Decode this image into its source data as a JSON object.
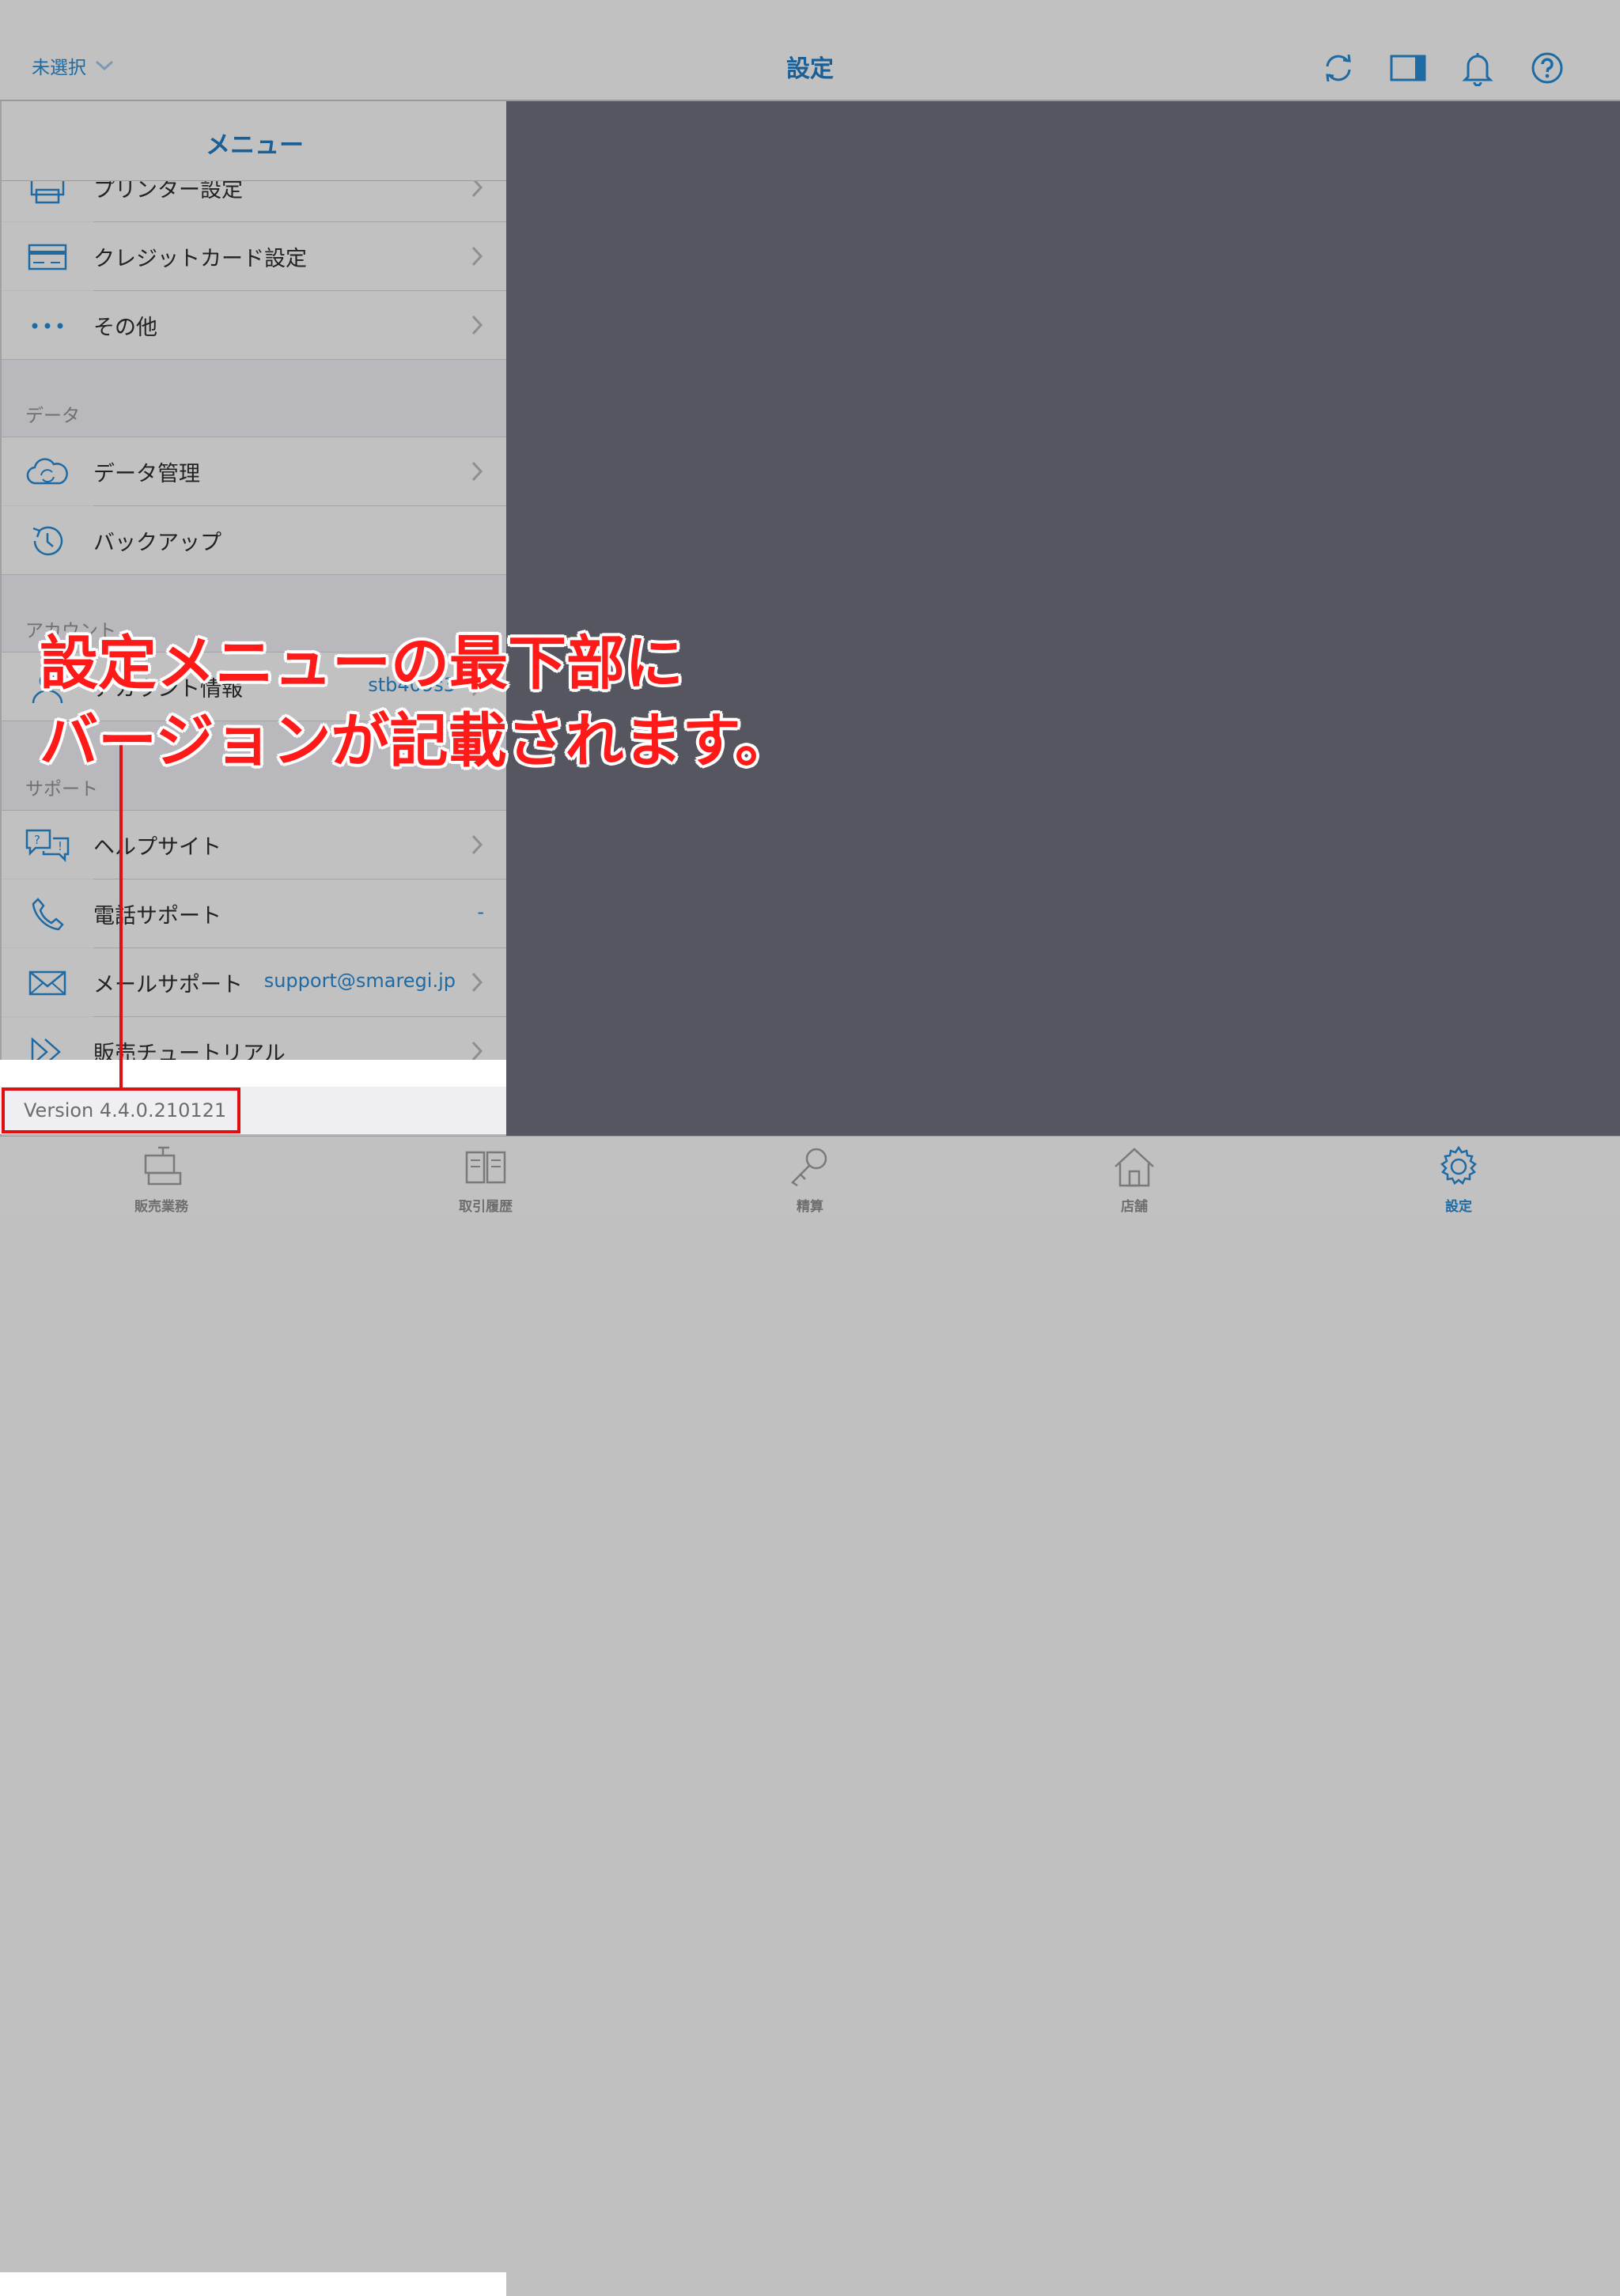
{
  "header": {
    "store_select": "未選択",
    "title": "設定"
  },
  "sidebar": {
    "title": "メニュー",
    "rows_top": [
      {
        "label": "プリンター設定",
        "icon": "printer-icon"
      },
      {
        "label": "クレジットカード設定",
        "icon": "credit-card-icon"
      },
      {
        "label": "その他",
        "icon": "more-dots-icon"
      }
    ],
    "section_data": "データ",
    "rows_data": [
      {
        "label": "データ管理",
        "icon": "cloud-sync-icon"
      },
      {
        "label": "バックアップ",
        "icon": "history-icon"
      }
    ],
    "section_account": "アカウント",
    "account": {
      "label": "アカウント情報",
      "value": "stb409s3",
      "icon": "user-icon"
    },
    "section_support": "サポート",
    "rows_support": [
      {
        "label": "ヘルプサイト",
        "icon": "help-chat-icon"
      },
      {
        "label": "電話サポート",
        "value": "-",
        "icon": "phone-icon"
      },
      {
        "label": "メールサポート",
        "value": "support@smaregi.jp",
        "icon": "mail-icon"
      },
      {
        "label": "販売チュートリアル",
        "icon": "fast-forward-icon"
      }
    ],
    "version": "Version 4.4.0.210121"
  },
  "tabbar": [
    {
      "label": "販売業務",
      "icon": "register-icon",
      "active": false
    },
    {
      "label": "取引履歴",
      "icon": "book-icon",
      "active": false
    },
    {
      "label": "精算",
      "icon": "key-icon",
      "active": false
    },
    {
      "label": "店舗",
      "icon": "home-icon",
      "active": false
    },
    {
      "label": "設定",
      "icon": "gear-icon",
      "active": true
    }
  ],
  "annotation": {
    "line1": "設定メニューの最下部に",
    "line2": "バージョンが記載されます。"
  },
  "colors": {
    "accent": "#1e6aa3",
    "highlight": "#e01010"
  }
}
